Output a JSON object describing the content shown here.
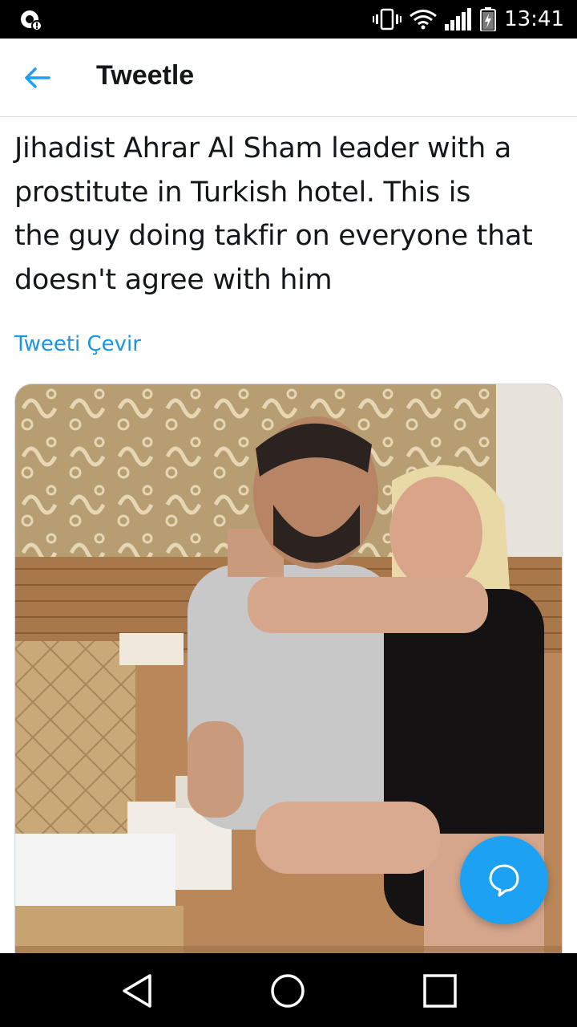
{
  "status_bar": {
    "time": "13:41",
    "left_icon": "notification-icon",
    "icons": [
      "vibrate-icon",
      "wifi-icon",
      "signal-icon",
      "battery-charging-icon"
    ]
  },
  "header": {
    "title": "Tweetle",
    "back_icon": "back-arrow-icon"
  },
  "tweet": {
    "lines": [
      "Jihadist Ahrar Al Sham leader with a",
      "prostitute in Turkish hotel. This is",
      "the guy doing takfir on everyone that",
      "doesn't agree with him"
    ],
    "translate_label": "Tweeti Çevir",
    "media_description_icon": "photo"
  },
  "fab": {
    "icon": "reply-bubble-icon"
  },
  "nav": {
    "back_icon": "nav-back-icon",
    "home_icon": "nav-home-icon",
    "recents_icon": "nav-recents-icon"
  },
  "colors": {
    "accent": "#1da1f2",
    "link": "#1b95e0",
    "text": "#14171a",
    "bars": "#000000"
  }
}
